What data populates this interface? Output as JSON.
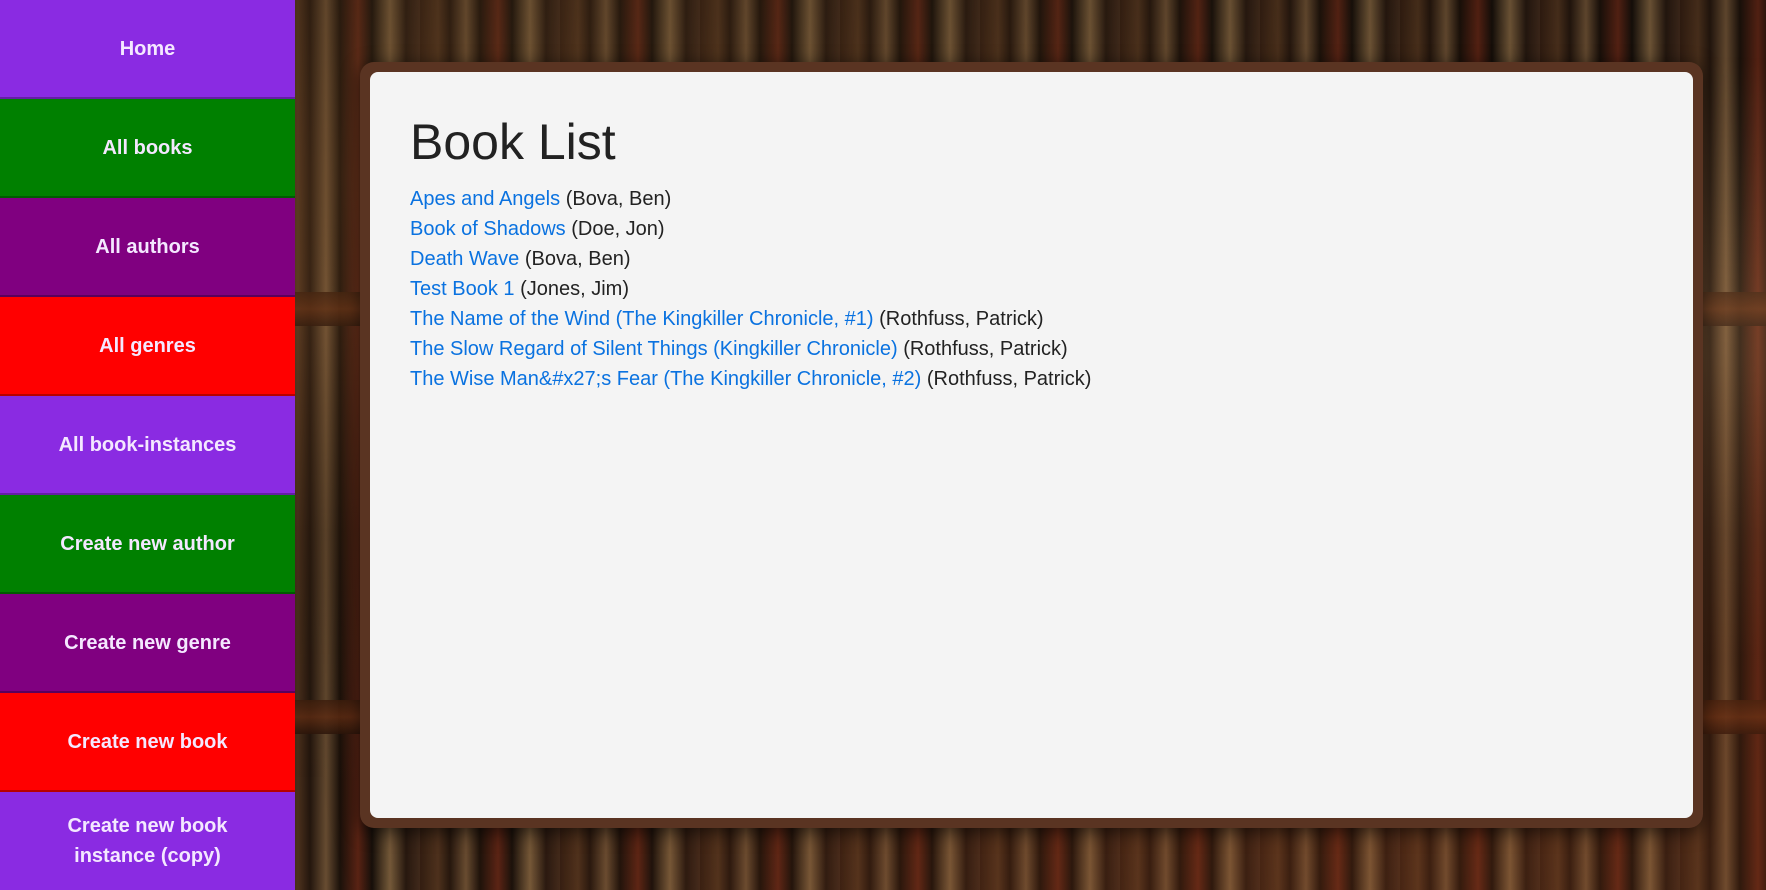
{
  "nav": {
    "items": [
      {
        "label": "Home",
        "color": "#8a2be2"
      },
      {
        "label": "All books",
        "color": "#008000"
      },
      {
        "label": "All authors",
        "color": "#800080"
      },
      {
        "label": "All genres",
        "color": "#ff0000"
      },
      {
        "label": "All book-instances",
        "color": "#8a2be2"
      },
      {
        "label": "Create new author",
        "color": "#008000"
      },
      {
        "label": "Create new genre",
        "color": "#800080"
      },
      {
        "label": "Create new book",
        "color": "#ff0000"
      },
      {
        "label": "Create new book instance (copy)",
        "color": "#8a2be2"
      }
    ]
  },
  "main": {
    "title": "Book List",
    "books": [
      {
        "title": "Apes and Angels",
        "author": "(Bova, Ben)"
      },
      {
        "title": "Book of Shadows",
        "author": "(Doe, Jon)"
      },
      {
        "title": "Death Wave",
        "author": "(Bova, Ben)"
      },
      {
        "title": "Test Book 1",
        "author": "(Jones, Jim)"
      },
      {
        "title": "The Name of the Wind (The Kingkiller Chronicle, #1)",
        "author": "(Rothfuss, Patrick)"
      },
      {
        "title": "The Slow Regard of Silent Things (Kingkiller Chronicle)",
        "author": "(Rothfuss, Patrick)"
      },
      {
        "title": "The Wise Man&#x27;s Fear (The Kingkiller Chronicle, #2)",
        "author": "(Rothfuss, Patrick)"
      }
    ]
  },
  "colors": {
    "link": "#0a72e0",
    "panel_bg": "#f4f4f4",
    "panel_frame": "#5a3422"
  }
}
